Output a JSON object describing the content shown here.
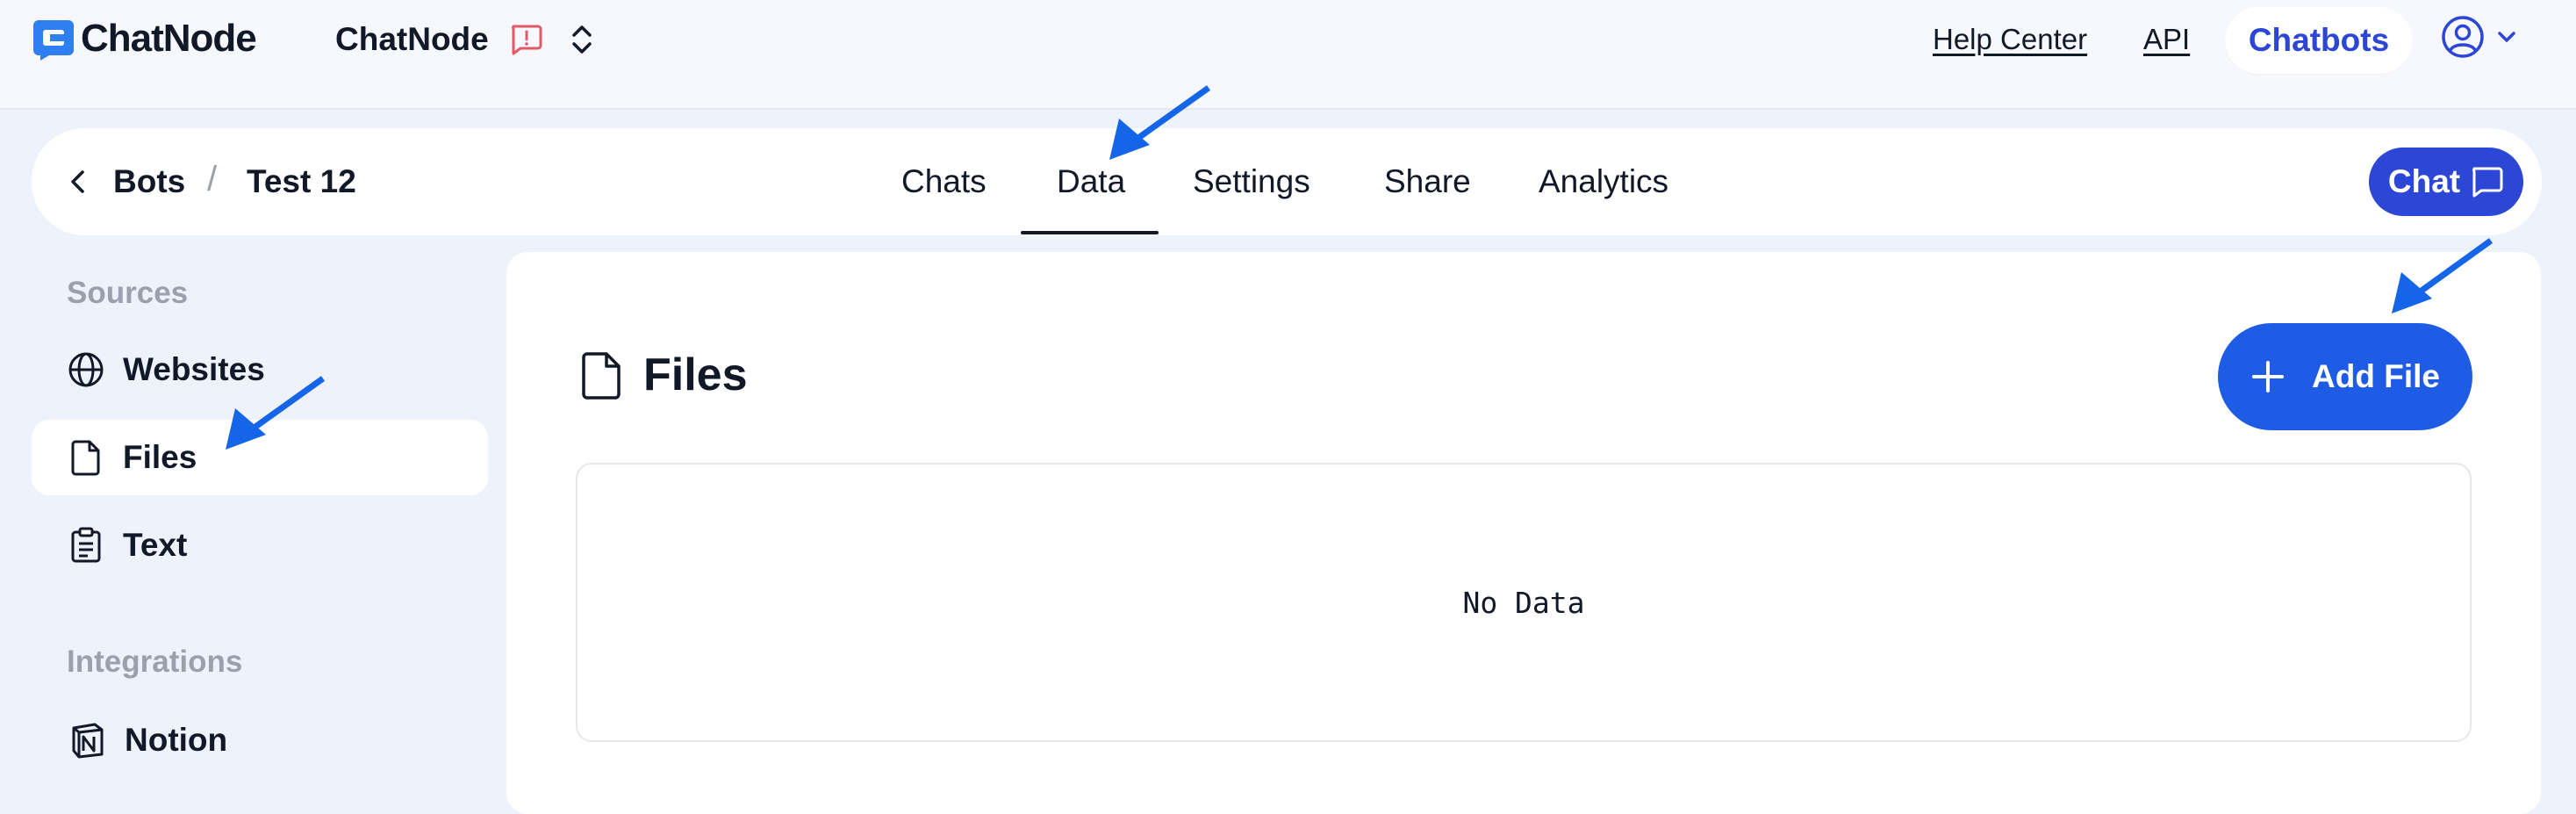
{
  "header": {
    "logo_text": "ChatNode",
    "workspace_name": "ChatNode",
    "help_center": "Help Center",
    "api": "API",
    "chatbots": "Chatbots"
  },
  "breadcrumb": {
    "bots": "Bots",
    "separator": "/",
    "current": "Test 12"
  },
  "tabs": [
    {
      "label": "Chats"
    },
    {
      "label": "Data",
      "active": true
    },
    {
      "label": "Settings"
    },
    {
      "label": "Share"
    },
    {
      "label": "Analytics"
    }
  ],
  "chat_button": "Chat",
  "sidebar": {
    "sources_label": "Sources",
    "items": [
      {
        "label": "Websites",
        "icon": "globe-icon"
      },
      {
        "label": "Files",
        "icon": "file-icon",
        "active": true
      },
      {
        "label": "Text",
        "icon": "clipboard-icon"
      }
    ],
    "integrations_label": "Integrations",
    "integrations": [
      {
        "label": "Notion",
        "icon": "notion-icon"
      }
    ]
  },
  "main": {
    "title": "Files",
    "add_button": "Add File",
    "empty_text": "No Data"
  },
  "colors": {
    "brand": "#2c46d6",
    "primary_button": "#1f5ce6",
    "background": "#eef2fb",
    "annotation_arrow": "#1565e8",
    "alert_icon": "#e05a6a"
  }
}
